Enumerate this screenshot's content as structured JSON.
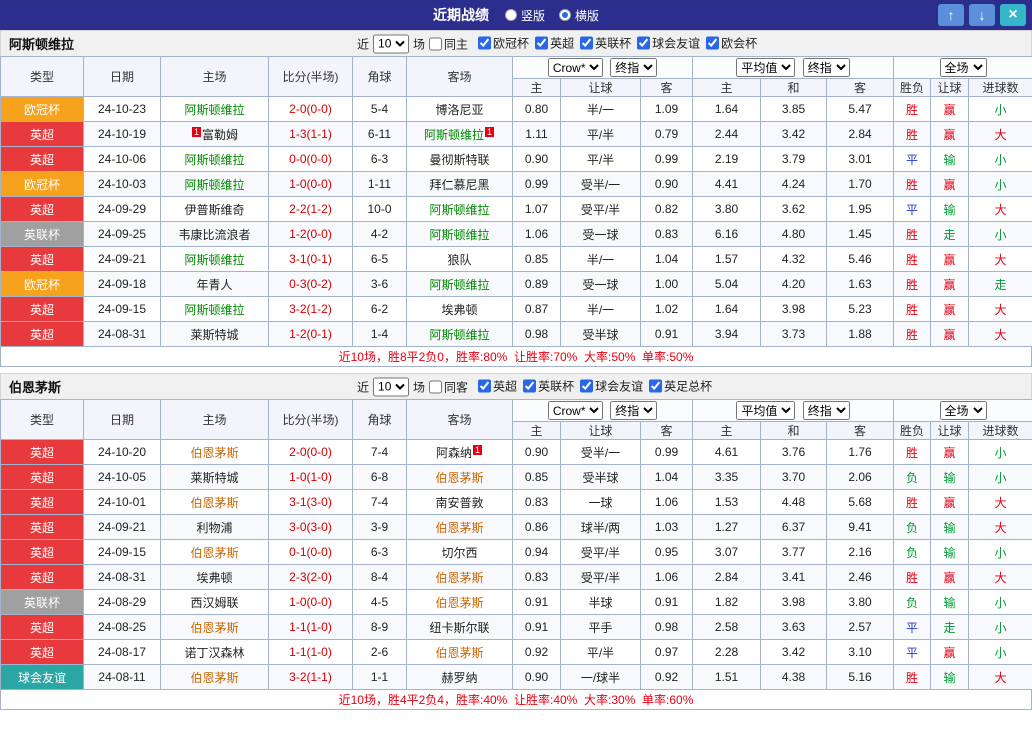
{
  "titlebar": {
    "title": "近期战绩",
    "view_modes": [
      {
        "label": "竖版",
        "selected": false
      },
      {
        "label": "横版",
        "selected": true
      }
    ],
    "window_buttons": {
      "up": "↑",
      "down": "↓",
      "close": "×"
    }
  },
  "columns": [
    "类型",
    "日期",
    "主场",
    "比分(半场)",
    "角球",
    "客场",
    "主",
    "让球",
    "客",
    "主",
    "和",
    "客",
    "胜负",
    "让球",
    "进球数"
  ],
  "type_colors": {
    "欧冠杯": "#f6a21d",
    "英超": "#e8393d",
    "英联杯": "#a0a0a0",
    "球会友谊": "#2aa7a5"
  },
  "result_colors": {
    "胜": "#e60012",
    "负": "#009933",
    "平": "#2438cd",
    "赢": "#e60012",
    "输": "#009933",
    "走": "#009933",
    "大": "#e60012",
    "小": "#009933"
  },
  "score_color": "#d40000",
  "sections": [
    {
      "team": "阿斯顿维拉",
      "team_color": "#008800",
      "filter": {
        "prefix": "近",
        "count": "10",
        "suffix": "场",
        "same_label": "同主",
        "same_checked": false,
        "competitions": [
          {
            "label": "欧冠杯",
            "checked": true
          },
          {
            "label": "英超",
            "checked": true
          },
          {
            "label": "英联杯",
            "checked": true
          },
          {
            "label": "球会友谊",
            "checked": true
          },
          {
            "label": "欧会杯",
            "checked": true
          }
        ]
      },
      "selects": {
        "bookmaker": "Crow*",
        "odds_type": "终指",
        "average": "平均值",
        "avg_type": "终指",
        "scope": "全场"
      },
      "rows": [
        {
          "type": "欧冠杯",
          "date": "24-10-23",
          "home": "阿斯顿维拉",
          "home_hl": true,
          "score": "2-0(0-0)",
          "corners": "5-4",
          "away": "博洛尼亚",
          "odds": [
            "0.80",
            "半/一",
            "1.09"
          ],
          "avg": [
            "1.64",
            "3.85",
            "5.47"
          ],
          "result": "胜",
          "handicap": "赢",
          "goals": "小"
        },
        {
          "type": "英超",
          "date": "24-10-19",
          "home": "富勒姆",
          "home_card_pre": "1",
          "score": "1-3(1-1)",
          "corners": "6-11",
          "away": "阿斯顿维拉",
          "away_hl": true,
          "away_card_post": "1",
          "odds": [
            "1.11",
            "平/半",
            "0.79"
          ],
          "avg": [
            "2.44",
            "3.42",
            "2.84"
          ],
          "result": "胜",
          "handicap": "赢",
          "goals": "大"
        },
        {
          "type": "英超",
          "date": "24-10-06",
          "home": "阿斯顿维拉",
          "home_hl": true,
          "score": "0-0(0-0)",
          "corners": "6-3",
          "away": "曼彻斯特联",
          "odds": [
            "0.90",
            "平/半",
            "0.99"
          ],
          "avg": [
            "2.19",
            "3.79",
            "3.01"
          ],
          "result": "平",
          "handicap": "输",
          "goals": "小"
        },
        {
          "type": "欧冠杯",
          "date": "24-10-03",
          "home": "阿斯顿维拉",
          "home_hl": true,
          "score": "1-0(0-0)",
          "corners": "1-11",
          "away": "拜仁慕尼黑",
          "odds": [
            "0.99",
            "受半/一",
            "0.90"
          ],
          "avg": [
            "4.41",
            "4.24",
            "1.70"
          ],
          "result": "胜",
          "handicap": "赢",
          "goals": "小"
        },
        {
          "type": "英超",
          "date": "24-09-29",
          "home": "伊普斯维奇",
          "score": "2-2(1-2)",
          "corners": "10-0",
          "away": "阿斯顿维拉",
          "away_hl": true,
          "odds": [
            "1.07",
            "受平/半",
            "0.82"
          ],
          "avg": [
            "3.80",
            "3.62",
            "1.95"
          ],
          "result": "平",
          "handicap": "输",
          "goals": "大"
        },
        {
          "type": "英联杯",
          "date": "24-09-25",
          "home": "韦康比流浪者",
          "score": "1-2(0-0)",
          "corners": "4-2",
          "away": "阿斯顿维拉",
          "away_hl": true,
          "odds": [
            "1.06",
            "受一球",
            "0.83"
          ],
          "avg": [
            "6.16",
            "4.80",
            "1.45"
          ],
          "result": "胜",
          "handicap": "走",
          "goals": "小"
        },
        {
          "type": "英超",
          "date": "24-09-21",
          "home": "阿斯顿维拉",
          "home_hl": true,
          "score": "3-1(0-1)",
          "corners": "6-5",
          "away": "狼队",
          "odds": [
            "0.85",
            "半/一",
            "1.04"
          ],
          "avg": [
            "1.57",
            "4.32",
            "5.46"
          ],
          "result": "胜",
          "handicap": "赢",
          "goals": "大"
        },
        {
          "type": "欧冠杯",
          "date": "24-09-18",
          "home": "年青人",
          "score": "0-3(0-2)",
          "corners": "3-6",
          "away": "阿斯顿维拉",
          "away_hl": true,
          "odds": [
            "0.89",
            "受一球",
            "1.00"
          ],
          "avg": [
            "5.04",
            "4.20",
            "1.63"
          ],
          "result": "胜",
          "handicap": "赢",
          "goals": "走"
        },
        {
          "type": "英超",
          "date": "24-09-15",
          "home": "阿斯顿维拉",
          "home_hl": true,
          "score": "3-2(1-2)",
          "corners": "6-2",
          "away": "埃弗顿",
          "odds": [
            "0.87",
            "半/一",
            "1.02"
          ],
          "avg": [
            "1.64",
            "3.98",
            "5.23"
          ],
          "result": "胜",
          "handicap": "赢",
          "goals": "大"
        },
        {
          "type": "英超",
          "date": "24-08-31",
          "home": "莱斯特城",
          "score": "1-2(0-1)",
          "corners": "1-4",
          "away": "阿斯顿维拉",
          "away_hl": true,
          "odds": [
            "0.98",
            "受半球",
            "0.91"
          ],
          "avg": [
            "3.94",
            "3.73",
            "1.88"
          ],
          "result": "胜",
          "handicap": "赢",
          "goals": "大"
        }
      ],
      "summary": "近10场，胜8平2负0，胜率:80%  让胜率:70%  大率:50%  单率:50%"
    },
    {
      "team": "伯恩茅斯",
      "team_color": "#cc6600",
      "filter": {
        "prefix": "近",
        "count": "10",
        "suffix": "场",
        "same_label": "同客",
        "same_checked": false,
        "competitions": [
          {
            "label": "英超",
            "checked": true
          },
          {
            "label": "英联杯",
            "checked": true
          },
          {
            "label": "球会友谊",
            "checked": true
          },
          {
            "label": "英足总杯",
            "checked": true
          }
        ]
      },
      "selects": {
        "bookmaker": "Crow*",
        "odds_type": "终指",
        "average": "平均值",
        "avg_type": "终指",
        "scope": "全场"
      },
      "rows": [
        {
          "type": "英超",
          "date": "24-10-20",
          "home": "伯恩茅斯",
          "home_hl": true,
          "score": "2-0(0-0)",
          "corners": "7-4",
          "away": "阿森纳",
          "away_card_post": "1",
          "odds": [
            "0.90",
            "受半/一",
            "0.99"
          ],
          "avg": [
            "4.61",
            "3.76",
            "1.76"
          ],
          "result": "胜",
          "handicap": "赢",
          "goals": "小"
        },
        {
          "type": "英超",
          "date": "24-10-05",
          "home": "莱斯特城",
          "score": "1-0(1-0)",
          "corners": "6-8",
          "away": "伯恩茅斯",
          "away_hl": true,
          "odds": [
            "0.85",
            "受半球",
            "1.04"
          ],
          "avg": [
            "3.35",
            "3.70",
            "2.06"
          ],
          "result": "负",
          "handicap": "输",
          "goals": "小"
        },
        {
          "type": "英超",
          "date": "24-10-01",
          "home": "伯恩茅斯",
          "home_hl": true,
          "score": "3-1(3-0)",
          "corners": "7-4",
          "away": "南安普敦",
          "odds": [
            "0.83",
            "一球",
            "1.06"
          ],
          "avg": [
            "1.53",
            "4.48",
            "5.68"
          ],
          "result": "胜",
          "handicap": "赢",
          "goals": "大"
        },
        {
          "type": "英超",
          "date": "24-09-21",
          "home": "利物浦",
          "score": "3-0(3-0)",
          "corners": "3-9",
          "away": "伯恩茅斯",
          "away_hl": true,
          "odds": [
            "0.86",
            "球半/两",
            "1.03"
          ],
          "avg": [
            "1.27",
            "6.37",
            "9.41"
          ],
          "result": "负",
          "handicap": "输",
          "goals": "大"
        },
        {
          "type": "英超",
          "date": "24-09-15",
          "home": "伯恩茅斯",
          "home_hl": true,
          "score": "0-1(0-0)",
          "corners": "6-3",
          "away": "切尔西",
          "odds": [
            "0.94",
            "受平/半",
            "0.95"
          ],
          "avg": [
            "3.07",
            "3.77",
            "2.16"
          ],
          "result": "负",
          "handicap": "输",
          "goals": "小"
        },
        {
          "type": "英超",
          "date": "24-08-31",
          "home": "埃弗顿",
          "score": "2-3(2-0)",
          "corners": "8-4",
          "away": "伯恩茅斯",
          "away_hl": true,
          "odds": [
            "0.83",
            "受平/半",
            "1.06"
          ],
          "avg": [
            "2.84",
            "3.41",
            "2.46"
          ],
          "result": "胜",
          "handicap": "赢",
          "goals": "大"
        },
        {
          "type": "英联杯",
          "date": "24-08-29",
          "home": "西汉姆联",
          "score": "1-0(0-0)",
          "corners": "4-5",
          "away": "伯恩茅斯",
          "away_hl": true,
          "odds": [
            "0.91",
            "半球",
            "0.91"
          ],
          "avg": [
            "1.82",
            "3.98",
            "3.80"
          ],
          "result": "负",
          "handicap": "输",
          "goals": "小"
        },
        {
          "type": "英超",
          "date": "24-08-25",
          "home": "伯恩茅斯",
          "home_hl": true,
          "score": "1-1(1-0)",
          "corners": "8-9",
          "away": "纽卡斯尔联",
          "odds": [
            "0.91",
            "平手",
            "0.98"
          ],
          "avg": [
            "2.58",
            "3.63",
            "2.57"
          ],
          "result": "平",
          "handicap": "走",
          "goals": "小"
        },
        {
          "type": "英超",
          "date": "24-08-17",
          "home": "诺丁汉森林",
          "score": "1-1(1-0)",
          "corners": "2-6",
          "away": "伯恩茅斯",
          "away_hl": true,
          "odds": [
            "0.92",
            "平/半",
            "0.97"
          ],
          "avg": [
            "2.28",
            "3.42",
            "3.10"
          ],
          "result": "平",
          "handicap": "赢",
          "goals": "小"
        },
        {
          "type": "球会友谊",
          "date": "24-08-11",
          "home": "伯恩茅斯",
          "home_hl": true,
          "score": "3-2(1-1)",
          "corners": "1-1",
          "away": "赫罗纳",
          "odds": [
            "0.90",
            "一/球半",
            "0.92"
          ],
          "avg": [
            "1.51",
            "4.38",
            "5.16"
          ],
          "result": "胜",
          "handicap": "输",
          "goals": "大"
        }
      ],
      "summary": "近10场，胜4平2负4，胜率:40%  让胜率:40%  大率:30%  单率:60%"
    }
  ]
}
